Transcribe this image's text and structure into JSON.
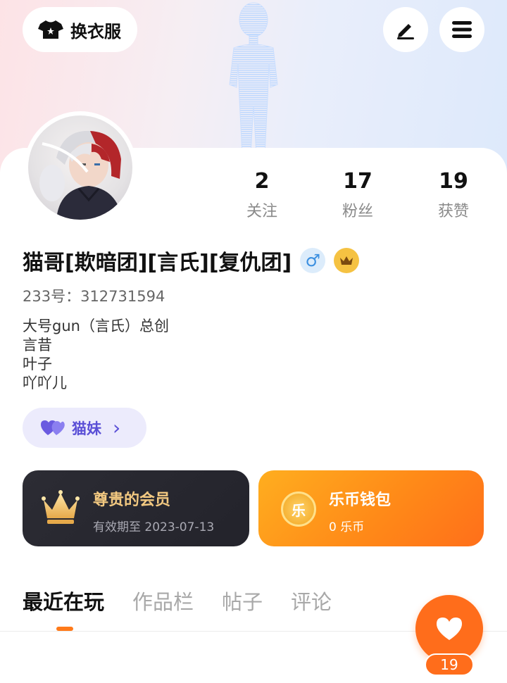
{
  "header": {
    "dress_up_label": "换衣服",
    "icons": {
      "dress_up": "shirt-icon",
      "edit": "pen-icon",
      "menu": "menu-icon"
    }
  },
  "stats": [
    {
      "value": "2",
      "label": "关注"
    },
    {
      "value": "17",
      "label": "粉丝"
    },
    {
      "value": "19",
      "label": "获赞"
    }
  ],
  "profile": {
    "name": "猫哥[欺暗团][言氏][复仇团]",
    "gender_symbol": "♂",
    "id_text": "233号：312731594",
    "bio": [
      "大号gun（言氏）总创",
      "言昔",
      "叶子",
      "吖吖儿"
    ],
    "cp_label": "猫妹",
    "cp_arrow": "›"
  },
  "vip": {
    "title": "尊贵的会员",
    "subtitle": "有效期至 2023-07-13"
  },
  "wallet": {
    "title": "乐币钱包",
    "subtitle": "0 乐币",
    "coin_glyph": "乐"
  },
  "tabs": [
    {
      "label": "最近在玩",
      "active": true
    },
    {
      "label": "作品栏",
      "active": false
    },
    {
      "label": "帖子",
      "active": false
    },
    {
      "label": "评论",
      "active": false
    }
  ],
  "like": {
    "count": "19"
  },
  "colors": {
    "accent": "#ff6d1b",
    "gender": "#3b8fe0",
    "crown": "#f5c242",
    "cp": "#5a4fd6"
  }
}
